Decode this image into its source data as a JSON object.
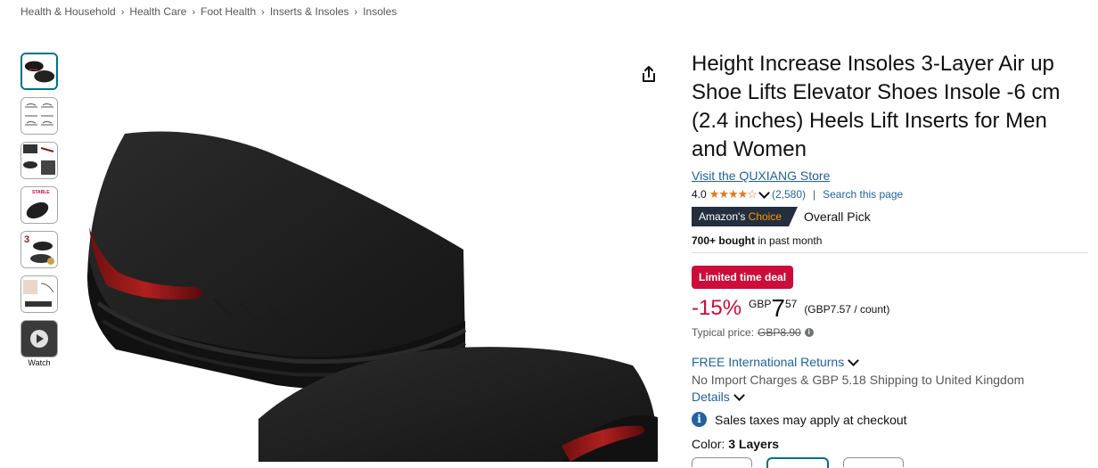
{
  "breadcrumb": {
    "items": [
      "Health & Household",
      "Health Care",
      "Foot Health",
      "Inserts & Insoles",
      "Insoles"
    ],
    "separator": "›"
  },
  "gallery": {
    "thumbnails": [
      "insole-pair-black",
      "size-chart",
      "insole-layers-detail",
      "stable-insole",
      "3-layer-lift",
      "foot-in-shoe",
      "video"
    ],
    "watch_label": "Watch",
    "selected_index": 0
  },
  "product": {
    "title": "Height Increase Insoles 3-Layer Air up Shoe Lifts Elevator Shoes Insole -6 cm (2.4 inches) Heels Lift Inserts for Men and Women",
    "store_link": "Visit the QUXIANG Store",
    "rating": {
      "value": "4.0",
      "stars": "★★★★☆",
      "star_fraction": 0.8,
      "review_count": "(2,580)",
      "separator": "|",
      "search_link": "Search this page"
    },
    "choice": {
      "badge_prefix": "Amazon's",
      "badge_suffix": "Choice",
      "pick": "Overall Pick"
    },
    "bought": {
      "bold": "700+ bought",
      "rest": "in past month"
    },
    "deal_badge": "Limited time deal",
    "price": {
      "discount": "-15%",
      "currency": "GBP",
      "whole": "7",
      "fraction": "57",
      "per_unit": "(GBP7.57 / count)",
      "typical_label": "Typical price:",
      "typical_value": "GBP8.90"
    },
    "delivery": {
      "returns": "FREE International Returns",
      "shipping": "No Import Charges & GBP 5.18 Shipping to United Kingdom",
      "details": "Details"
    },
    "tax_note": "Sales taxes may apply at checkout",
    "color": {
      "label": "Color:",
      "value": "3 Layers"
    }
  },
  "colors": {
    "link": "#2162a1",
    "deal_red": "#cc0c39",
    "star": "#de7921",
    "badge_dark": "#232f3e",
    "badge_orange": "#ff9900",
    "insole_black": "#1a1a1a",
    "air_red": "#8b1a1a"
  },
  "icons": {
    "share": "share-icon",
    "info": "info-icon",
    "chevron": "chevron-down-icon",
    "play": "play-icon"
  }
}
